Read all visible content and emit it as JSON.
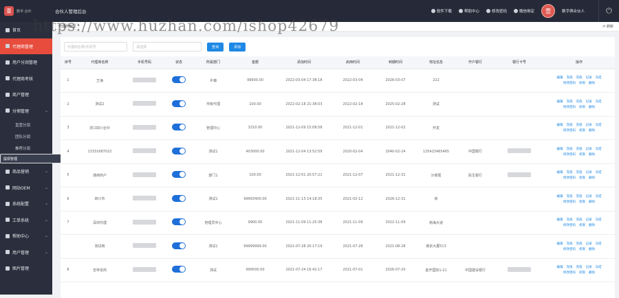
{
  "topbar": {
    "logo_mark": "壹",
    "logo_text": "数字·合伙",
    "title": "合伙人管理后台",
    "links": [
      {
        "icon": "download-icon",
        "label": "软件下载"
      },
      {
        "icon": "help-icon",
        "label": "帮助中心"
      },
      {
        "icon": "key-icon",
        "label": "修改密码"
      },
      {
        "icon": "wechat-icon",
        "label": "微信绑定"
      }
    ],
    "avatar": "壹",
    "username": "数字俱合伙人"
  },
  "sidebar": {
    "items": [
      {
        "label": "首页",
        "active": false,
        "chev": false
      },
      {
        "label": "代理商管理",
        "active": true,
        "chev": false
      },
      {
        "label": "用户分润管理",
        "active": false,
        "chev": false
      },
      {
        "label": "代理商考核",
        "active": false,
        "chev": false
      },
      {
        "label": "商户管理",
        "active": false,
        "chev": false
      },
      {
        "label": "分佣管理",
        "active": false,
        "chev": true
      }
    ],
    "sub_items": [
      "直营分润",
      "团队分润",
      "推荐分润",
      "提现管理"
    ],
    "more_items": [
      {
        "label": "商品营销",
        "chev": true
      },
      {
        "label": "网站OEM",
        "chev": true
      },
      {
        "label": "系统配置",
        "chev": true
      },
      {
        "label": "工单系统",
        "chev": true
      },
      {
        "label": "帮助中心",
        "chev": true
      },
      {
        "label": "用户管理",
        "chev": true
      },
      {
        "label": "图片管理",
        "chev": false
      }
    ]
  },
  "tabbar": {
    "tab": "代理商管理",
    "refresh": "刷新"
  },
  "filters": {
    "search_placeholder": "代理商名称/手机号",
    "select_placeholder": "请选择",
    "query_label": "查询",
    "add_label": "添加"
  },
  "table": {
    "columns": [
      "序号",
      "代理商名称",
      "手机号码",
      "状态",
      "所属部门",
      "金额",
      "添加时间",
      "启用时间",
      "到期时间",
      "地址信息",
      "开户银行",
      "银行卡号",
      "操作"
    ],
    "rows": [
      {
        "no": "1",
        "name": "王海",
        "dept": "乡镇",
        "amount": "99900.00",
        "added": "2022-03-04 17:38:18",
        "start": "2022-03-04",
        "end": "2026-03-07",
        "addr": "222",
        "bank": "",
        "card": false
      },
      {
        "no": "2",
        "name": "测试2",
        "dept": "市级代理",
        "amount": "100.00",
        "added": "2022-02-18 21:38:03",
        "start": "2022-02-18",
        "end": "2025-02-28",
        "addr": "测试",
        "bank": "",
        "card": false
      },
      {
        "no": "3",
        "name": "浙江四川合伙",
        "dept": "管理中心",
        "amount": "3210.00",
        "added": "2021-12-09 15:08:58",
        "start": "2021-12-01",
        "end": "2021-12-02",
        "addr": "开发",
        "bank": "",
        "card": false
      },
      {
        "no": "4",
        "name": "13331687022",
        "dept": "测试1",
        "amount": "403000.00",
        "added": "2021-12-04 13:52:59",
        "start": "2020-02-04",
        "end": "2040-02-24",
        "addr": "125423465465",
        "bank": "中国银行",
        "card": true
      },
      {
        "no": "5",
        "name": "通用商户",
        "dept": "部门1",
        "amount": "100.00",
        "added": "2021-12-01 20:57:21",
        "start": "2021-12-07",
        "end": "2021-12-31",
        "addr": "沙坡尾",
        "bank": "民生银行",
        "card": true
      },
      {
        "no": "6",
        "name": "四川市",
        "dept": "测试1",
        "amount": "99993400.00",
        "added": "2021-11-13 14:18:35",
        "start": "2021-02-12",
        "end": "2026-12-31",
        "addr": "商",
        "bank": "",
        "card": false
      },
      {
        "no": "7",
        "name": "深圳代理",
        "dept": "管理员中心",
        "amount": "9900.00",
        "added": "2021-11-09 11:25:38",
        "start": "2021-11-09",
        "end": "2022-11-09",
        "addr": "南海大道",
        "bank": "",
        "card": false
      },
      {
        "no": "",
        "name": "测试用",
        "dept": "测试1",
        "amount": "99999999.00",
        "added": "2021-07-28 20:17:19",
        "start": "2021-07-28",
        "end": "2021-08-28",
        "addr": "南京大厦513",
        "bank": "",
        "card": false
      },
      {
        "no": "8",
        "name": "吉林省商",
        "dept": "测试",
        "amount": "999500.00",
        "added": "2021-07-24 16:42:17",
        "start": "2021-07-01",
        "end": "2026-07-20",
        "addr": "金开国际1-21",
        "bank": "中国建设银行",
        "card": true
      }
    ],
    "op_sets": [
      [
        "编辑",
        "充值",
        "充值",
        "记录"
      ],
      [
        "冻结",
        "修改密码",
        "权限",
        "删除"
      ]
    ]
  },
  "watermark": "https://www.huzhan.com/ishop42679"
}
